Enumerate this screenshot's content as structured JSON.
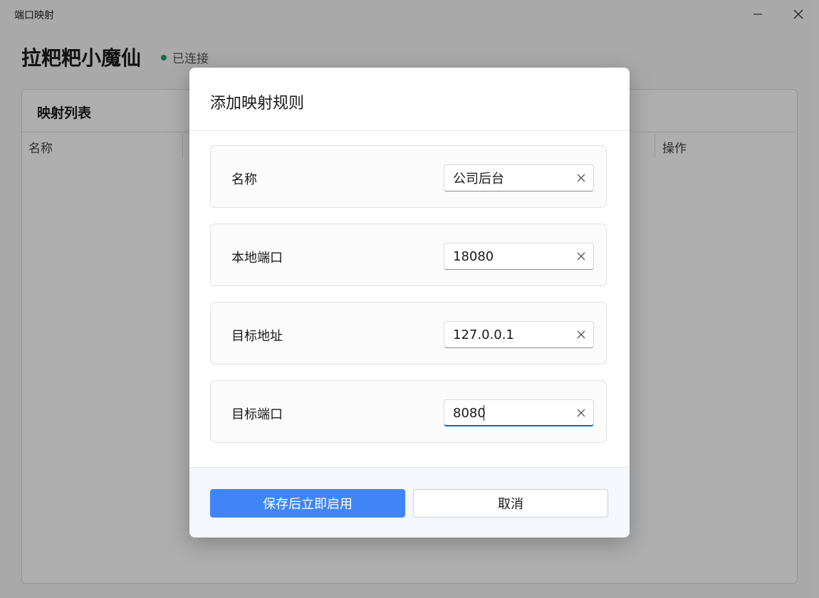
{
  "window": {
    "title": "端口映射"
  },
  "device": {
    "name": "拉粑粑小魔仙",
    "status_text": "已连接",
    "status_color": "#19a35b"
  },
  "list": {
    "title": "映射列表",
    "columns": {
      "name": "名称",
      "ops": "操作"
    }
  },
  "dialog": {
    "title": "添加映射规则",
    "fields": [
      {
        "label": "名称",
        "value": "公司后台"
      },
      {
        "label": "本地端口",
        "value": "18080"
      },
      {
        "label": "目标地址",
        "value": "127.0.0.1"
      },
      {
        "label": "目标端口",
        "value": "8080",
        "focused": true
      }
    ],
    "primary_button": "保存后立即启用",
    "secondary_button": "取消",
    "accent_color": "#3f85f8"
  }
}
